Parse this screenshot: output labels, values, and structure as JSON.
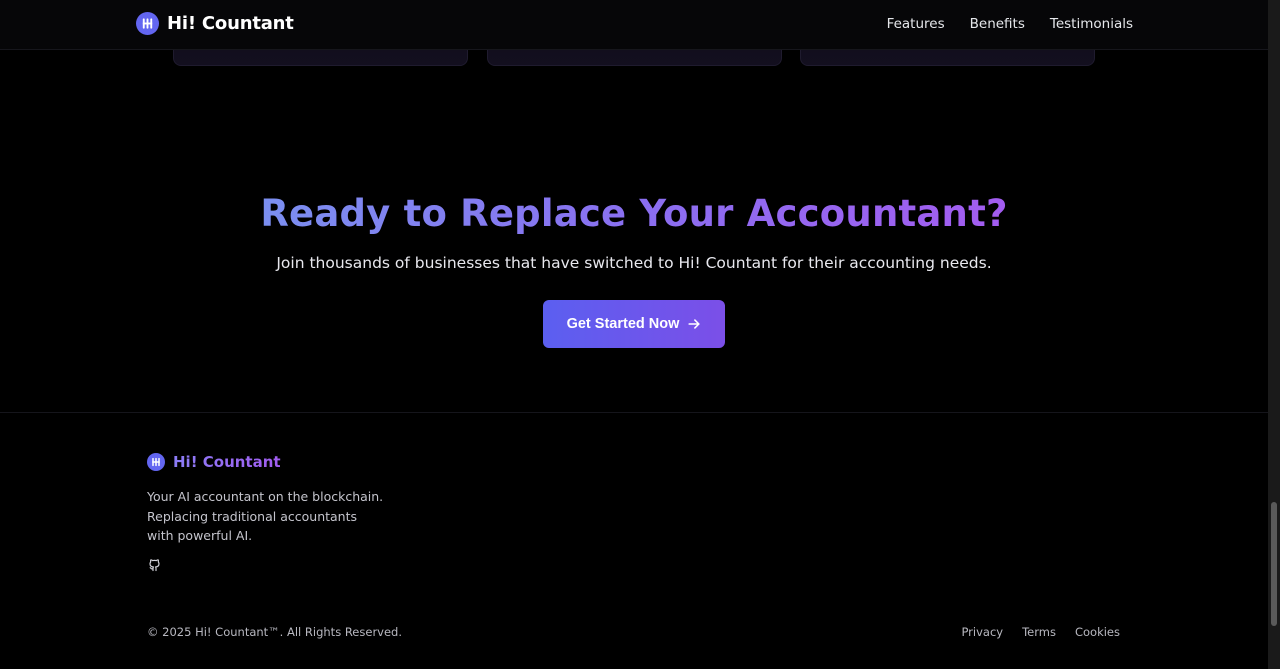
{
  "nav": {
    "brand": "Hi! Countant",
    "links": [
      "Features",
      "Benefits",
      "Testimonials"
    ]
  },
  "cta": {
    "title": "Ready to Replace Your Accountant?",
    "subtitle": "Join thousands of businesses that have switched to Hi! Countant for their accounting needs.",
    "button_label": "Get Started Now"
  },
  "footer": {
    "brand": "Hi! Countant",
    "description": "Your AI accountant on the blockchain. Replacing traditional accountants with powerful AI.",
    "social_icon": "github-icon",
    "copyright": "© 2025 Hi! Countant™. All Rights Reserved.",
    "legal_links": [
      "Privacy",
      "Terms",
      "Cookies"
    ]
  },
  "colors": {
    "background": "#000000",
    "accent_start": "#6366f1",
    "accent_end": "#8b45e8"
  },
  "icons": {
    "logo": "logo-icon",
    "arrow": "arrow-right-icon"
  }
}
